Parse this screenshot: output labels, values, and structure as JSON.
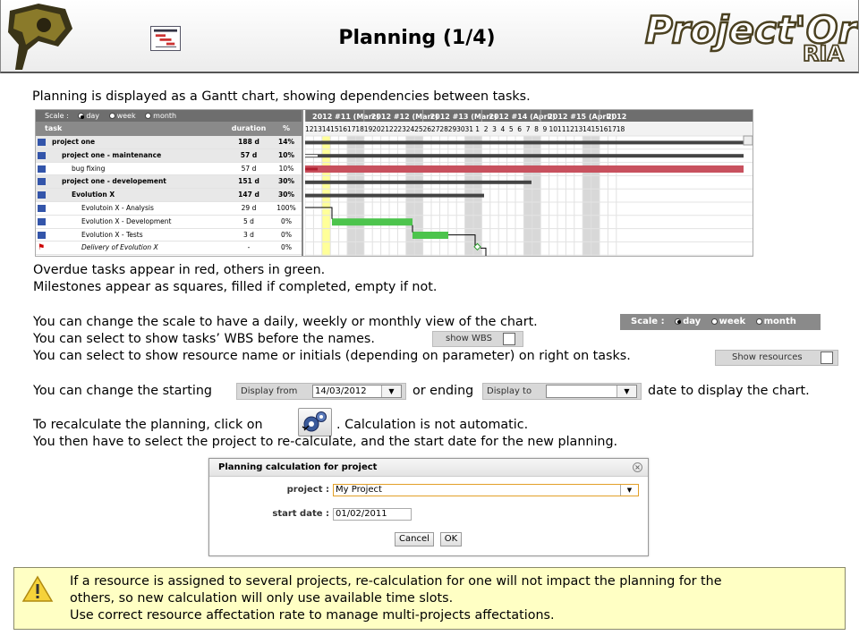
{
  "header": {
    "title": "Planning (1/4)",
    "brand_main": "Project'Or",
    "brand_sub": "RIA"
  },
  "intro": "Planning is displayed as a Gantt chart, showing dependencies between tasks.",
  "gantt": {
    "scale_label": "Scale :",
    "scale_options": [
      "day",
      "week",
      "month"
    ],
    "selected_scale": "day",
    "col_task": "task",
    "col_duration": "duration",
    "col_pct": "%",
    "weeks": [
      "2012 #11 (Marc)",
      "2012 #12 (Marc)",
      "2012 #13 (Marc)",
      "2012 #14 (April)",
      "2012 #15 (April)",
      "2012"
    ],
    "days": [
      "12",
      "13",
      "14",
      "15",
      "16",
      "17",
      "18",
      "19",
      "20",
      "21",
      "22",
      "23",
      "24",
      "25",
      "26",
      "27",
      "28",
      "29",
      "30",
      "31",
      "1",
      "2",
      "3",
      "4",
      "5",
      "6",
      "7",
      "8",
      "9",
      "10",
      "11",
      "12",
      "13",
      "14",
      "15",
      "16",
      "17",
      "18"
    ],
    "today": "14",
    "rows": [
      {
        "name": "project one",
        "duration": "188 d",
        "pct": "14%",
        "level": 0,
        "type": "project"
      },
      {
        "name": "project one - maintenance",
        "duration": "57 d",
        "pct": "10%",
        "level": 1,
        "type": "project"
      },
      {
        "name": "bug fixing",
        "duration": "57 d",
        "pct": "10%",
        "level": 2,
        "type": "activity"
      },
      {
        "name": "project one - developement",
        "duration": "151 d",
        "pct": "30%",
        "level": 1,
        "type": "project"
      },
      {
        "name": "Evolution X",
        "duration": "147 d",
        "pct": "30%",
        "level": 2,
        "type": "activity"
      },
      {
        "name": "Evolutoin X - Analysis",
        "duration": "29 d",
        "pct": "100%",
        "level": 3,
        "type": "task"
      },
      {
        "name": "Evolution X - Development",
        "duration": "5 d",
        "pct": "0%",
        "level": 3,
        "type": "task"
      },
      {
        "name": "Evolution X - Tests",
        "duration": "3 d",
        "pct": "0%",
        "level": 3,
        "type": "task"
      },
      {
        "name": "Delivery of Evolution X",
        "duration": "-",
        "pct": "0%",
        "level": 3,
        "type": "milestone"
      }
    ]
  },
  "text": {
    "overdue": "Overdue tasks appear in red, others in green.",
    "milestones": "Milestones appear as squares, filled if completed, empty if not.",
    "scale": "You can change the scale to have a daily, weekly or monthly view of the chart.",
    "wbs": "You can select to show tasks’ WBS before the names.",
    "resources": "You can select to show resource name or initials  (depending on parameter) on right on tasks.",
    "starting_pre": "You can change the starting",
    "starting_mid": "or ending",
    "starting_post": "date to display the chart.",
    "recalc_pre": "To recalculate the planning, click on",
    "recalc_post": ". Calculation is not automatic.",
    "select_project": "You then have to select the project to re-calculate, and the start date for the new planning."
  },
  "widgets": {
    "show_wbs": "show WBS",
    "show_resources": "Show resources",
    "display_from": "Display from",
    "display_from_value": "14/03/2012",
    "display_to": "Display to",
    "display_to_value": ""
  },
  "dialog": {
    "title": "Planning calculation for project",
    "project_label": "project :",
    "project_value": "My Project",
    "start_label": "start date :",
    "start_value": "01/02/2011",
    "cancel": "Cancel",
    "ok": "OK"
  },
  "warning": {
    "line1": "If a resource is assigned to several projects, re-calculation for one will not impact the planning for the",
    "line2": "others, so new calculation will only use available time slots.",
    "line3": "Use correct resource affectation rate to manage multi-projects affectations."
  },
  "colors": {
    "overdue": "#c8515e",
    "ontime": "#4cc44c",
    "summary": "#444444",
    "today": "#ffff99",
    "weekend": "#d8d8d8",
    "warning_bg": "#ffffc4"
  }
}
